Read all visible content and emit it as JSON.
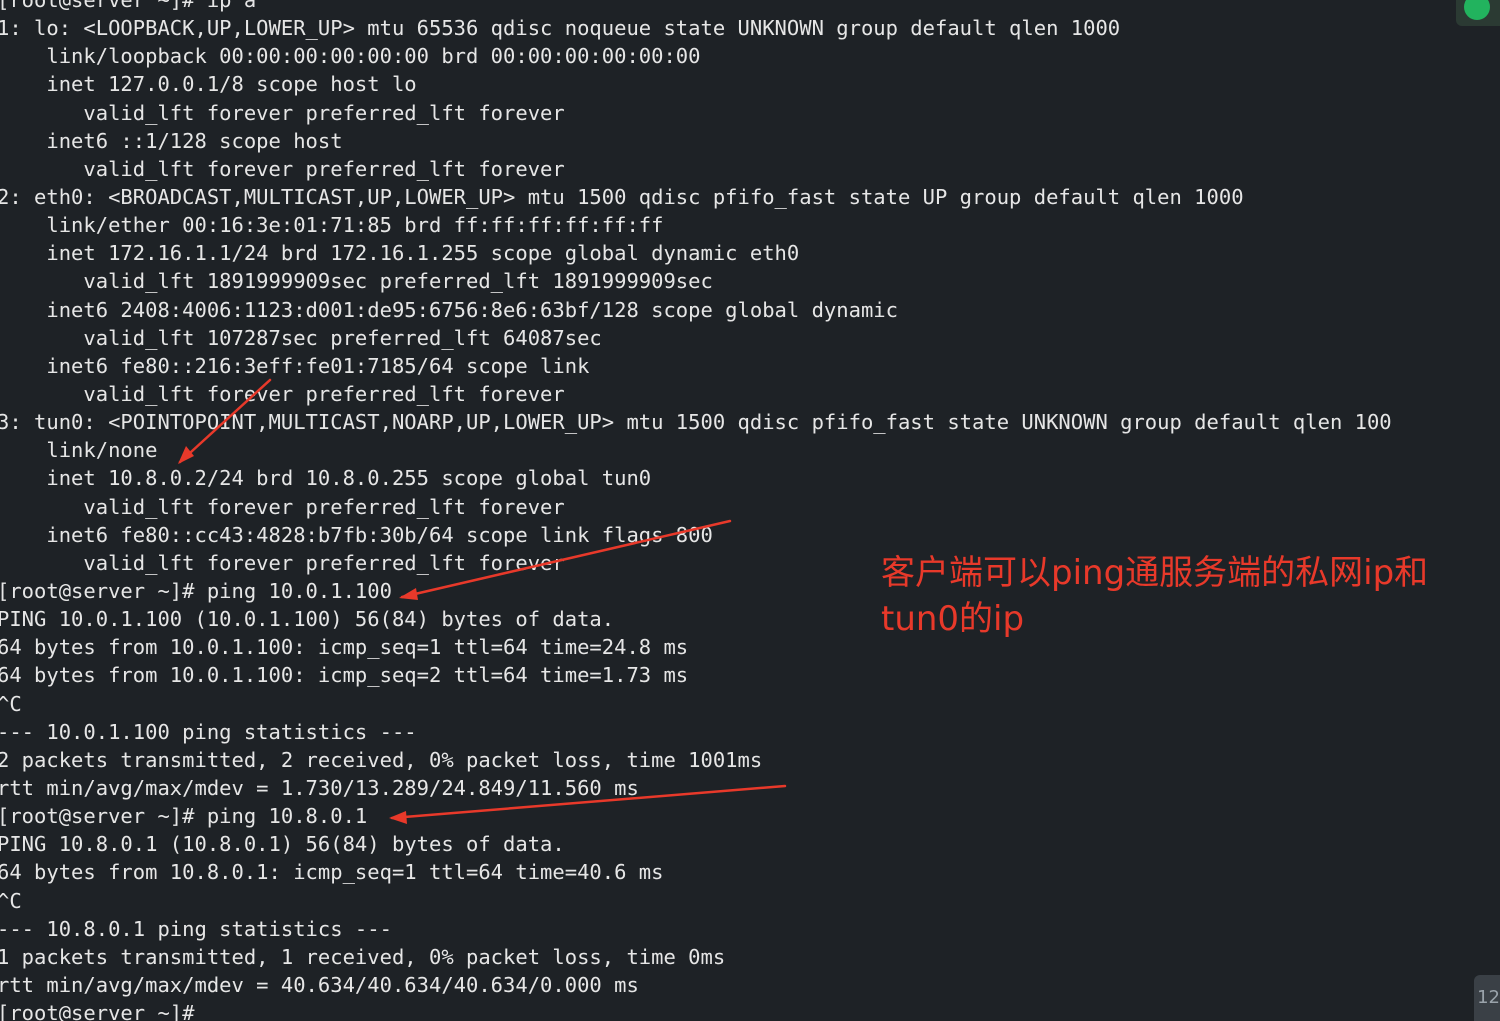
{
  "terminal": {
    "lines": [
      "[root@server ~]# ip a",
      "1: lo: <LOOPBACK,UP,LOWER_UP> mtu 65536 qdisc noqueue state UNKNOWN group default qlen 1000",
      "    link/loopback 00:00:00:00:00:00 brd 00:00:00:00:00:00",
      "    inet 127.0.0.1/8 scope host lo",
      "       valid_lft forever preferred_lft forever",
      "    inet6 ::1/128 scope host",
      "       valid_lft forever preferred_lft forever",
      "2: eth0: <BROADCAST,MULTICAST,UP,LOWER_UP> mtu 1500 qdisc pfifo_fast state UP group default qlen 1000",
      "    link/ether 00:16:3e:01:71:85 brd ff:ff:ff:ff:ff:ff",
      "    inet 172.16.1.1/24 brd 172.16.1.255 scope global dynamic eth0",
      "       valid_lft 1891999909sec preferred_lft 1891999909sec",
      "    inet6 2408:4006:1123:d001:de95:6756:8e6:63bf/128 scope global dynamic",
      "       valid_lft 107287sec preferred_lft 64087sec",
      "    inet6 fe80::216:3eff:fe01:7185/64 scope link",
      "       valid_lft forever preferred_lft forever",
      "3: tun0: <POINTOPOINT,MULTICAST,NOARP,UP,LOWER_UP> mtu 1500 qdisc pfifo_fast state UNKNOWN group default qlen 100",
      "    link/none",
      "    inet 10.8.0.2/24 brd 10.8.0.255 scope global tun0",
      "       valid_lft forever preferred_lft forever",
      "    inet6 fe80::cc43:4828:b7fb:30b/64 scope link flags 800",
      "       valid_lft forever preferred_lft forever",
      "[root@server ~]# ping 10.0.1.100",
      "PING 10.0.1.100 (10.0.1.100) 56(84) bytes of data.",
      "64 bytes from 10.0.1.100: icmp_seq=1 ttl=64 time=24.8 ms",
      "64 bytes from 10.0.1.100: icmp_seq=2 ttl=64 time=1.73 ms",
      "^C",
      "--- 10.0.1.100 ping statistics ---",
      "2 packets transmitted, 2 received, 0% packet loss, time 1001ms",
      "rtt min/avg/max/mdev = 1.730/13.289/24.849/11.560 ms",
      "[root@server ~]# ping 10.8.0.1",
      "PING 10.8.0.1 (10.8.0.1) 56(84) bytes of data.",
      "64 bytes from 10.8.0.1: icmp_seq=1 ttl=64 time=40.6 ms",
      "^C",
      "--- 10.8.0.1 ping statistics ---",
      "1 packets transmitted, 1 received, 0% packet loss, time 0ms",
      "rtt min/avg/max/mdev = 40.634/40.634/40.634/0.000 ms",
      "[root@server ~]#"
    ]
  },
  "annotation": {
    "text": "客户端可以ping通服务端的私网ip和tun0的ip"
  },
  "colors": {
    "terminal_bg": "#1e2226",
    "terminal_fg": "#e6e6e6",
    "annotation": "#e8392a",
    "status_ok": "#22b35e"
  },
  "icons": {
    "status": "check-circle-icon"
  },
  "corner_widget": {
    "label": "12"
  }
}
